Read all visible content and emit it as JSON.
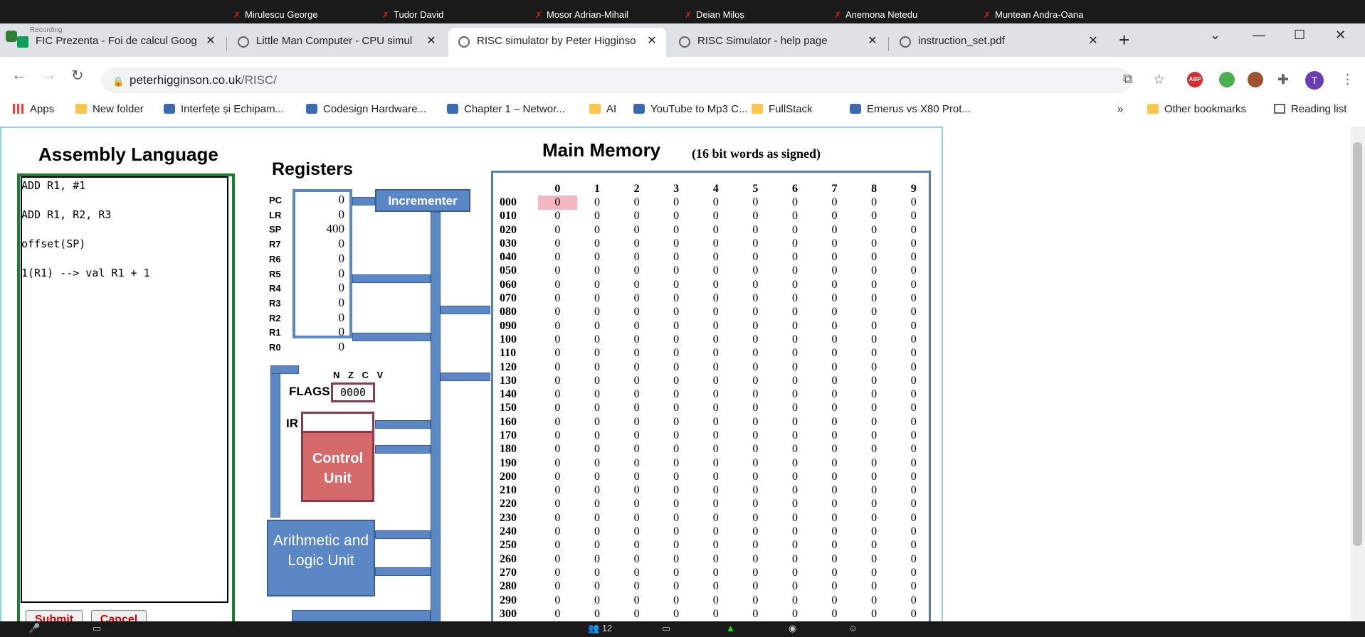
{
  "participants": [
    "Mirulescu George",
    "Tudor David",
    "Mosor Adrian-Mihail",
    "Deian Miloș",
    "Anemona Netedu",
    "Muntean Andra-Oana"
  ],
  "recording_label": "Recording",
  "tabs": [
    {
      "title": "FIC Prezenta - Foi de calcul Goog",
      "active": false
    },
    {
      "title": "Little Man Computer - CPU simul",
      "active": false
    },
    {
      "title": "RISC simulator by Peter Higginso",
      "active": true
    },
    {
      "title": "RISC Simulator - help page",
      "active": false
    },
    {
      "title": "instruction_set.pdf",
      "active": false
    }
  ],
  "address": {
    "host": "peterhigginson.co.uk",
    "path": "/RISC/"
  },
  "bookmarks": [
    "Apps",
    "New folder",
    "Interfețe și Echipam...",
    "Codesign Hardware...",
    "Chapter 1 – Networ...",
    "AI",
    "YouTube to Mp3 C...",
    "FullStack",
    "Emerus vs X80 Prot..."
  ],
  "bookmarks_right": {
    "overflow": "»",
    "other": "Other bookmarks",
    "reading": "Reading list"
  },
  "avatar_letter": "T",
  "assembly": {
    "title": "Assembly Language",
    "lines": [
      "ADD R1, #1",
      "ADD R1, R2, R3",
      "offset(SP)",
      "1(R1) --> val R1 + 1"
    ],
    "submit": "Submit",
    "cancel": "Cancel"
  },
  "registers": {
    "title": "Registers",
    "items": [
      {
        "name": "PC",
        "value": "0"
      },
      {
        "name": "LR",
        "value": "0"
      },
      {
        "name": "SP",
        "value": "400"
      },
      {
        "name": "R7",
        "value": "0"
      },
      {
        "name": "R6",
        "value": "0"
      },
      {
        "name": "R5",
        "value": "0"
      },
      {
        "name": "R4",
        "value": "0"
      },
      {
        "name": "R3",
        "value": "0"
      },
      {
        "name": "R2",
        "value": "0"
      },
      {
        "name": "R1",
        "value": "0"
      },
      {
        "name": "R0",
        "value": "0"
      }
    ],
    "incrementer": "Incrementer",
    "flags_label": "FLAGS",
    "flags_names": "N Z C V",
    "flags_value": "0000",
    "ir_label": "IR",
    "control_unit": "Control Unit",
    "alu": "Arithmetic and Logic Unit"
  },
  "memory": {
    "title": "Main Memory",
    "subtitle": "(16 bit words as signed)",
    "columns": [
      "0",
      "1",
      "2",
      "3",
      "4",
      "5",
      "6",
      "7",
      "8",
      "9"
    ],
    "rows": [
      "000",
      "010",
      "020",
      "030",
      "040",
      "050",
      "060",
      "070",
      "080",
      "090",
      "100",
      "110",
      "120",
      "130",
      "140",
      "150",
      "160",
      "170",
      "180",
      "190",
      "200",
      "210",
      "220",
      "230",
      "240",
      "250",
      "260",
      "270",
      "280",
      "290",
      "300"
    ],
    "value": "0",
    "highlight_color": "#f4b6c2"
  },
  "zoom": {
    "participants_count": "12"
  }
}
